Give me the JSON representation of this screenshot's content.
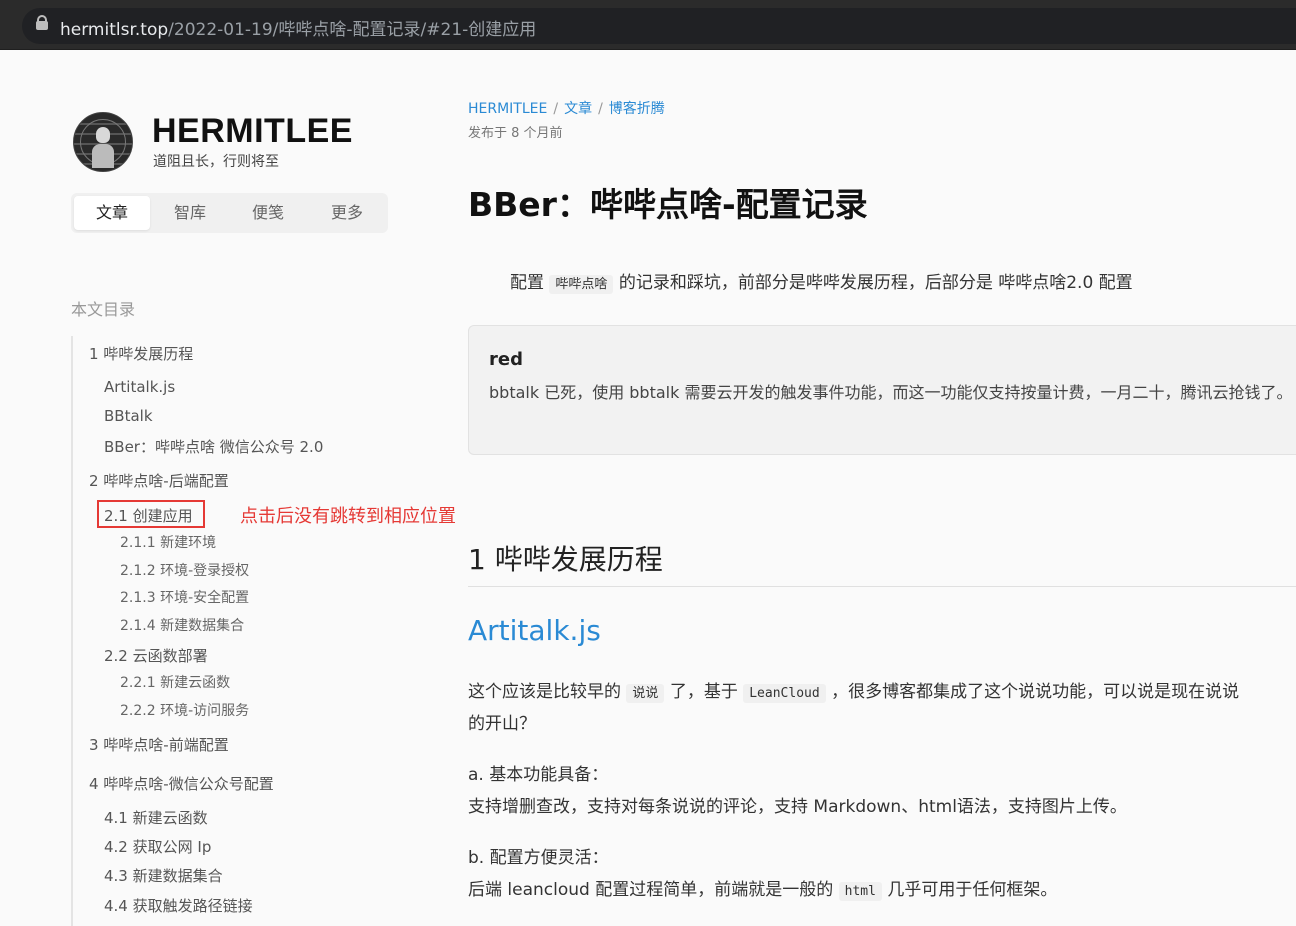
{
  "browser": {
    "url_host": "hermitlsr.top",
    "url_path": "/2022-01-19/哔哔点啥-配置记录/#21-创建应用"
  },
  "site": {
    "title": "HERMITLEE",
    "subtitle": "道阻且长，行则将至"
  },
  "nav": {
    "tabs": [
      {
        "label": "文章",
        "active": true
      },
      {
        "label": "智库",
        "active": false
      },
      {
        "label": "便笺",
        "active": false
      },
      {
        "label": "更多",
        "active": false
      }
    ]
  },
  "toc": {
    "title": "本文目录",
    "items": [
      {
        "label": "1 哔哔发展历程",
        "level": 1
      },
      {
        "label": "Artitalk.js",
        "level": 2
      },
      {
        "label": "BBtalk",
        "level": 2
      },
      {
        "label": "BBer：哔哔点啥 微信公众号 2.0",
        "level": 2
      },
      {
        "label": "2 哔哔点啥-后端配置",
        "level": 1
      },
      {
        "label": "2.1 创建应用",
        "level": 2,
        "highlighted": true
      },
      {
        "label": "2.1.1 新建环境",
        "level": 3
      },
      {
        "label": "2.1.2 环境-登录授权",
        "level": 3
      },
      {
        "label": "2.1.3 环境-安全配置",
        "level": 3
      },
      {
        "label": "2.1.4 新建数据集合",
        "level": 3
      },
      {
        "label": "2.2 云函数部署",
        "level": 2
      },
      {
        "label": "2.2.1 新建云函数",
        "level": 3
      },
      {
        "label": "2.2.2 环境-访问服务",
        "level": 3
      },
      {
        "label": "3 哔哔点啥-前端配置",
        "level": 1
      },
      {
        "label": "4 哔哔点啥-微信公众号配置",
        "level": 1
      },
      {
        "label": "4.1 新建云函数",
        "level": 2
      },
      {
        "label": "4.2 获取公网 Ip",
        "level": 2
      },
      {
        "label": "4.3 新建数据集合",
        "level": 2
      },
      {
        "label": "4.4 获取触发路径链接",
        "level": 2
      }
    ],
    "annotation": "点击后没有跳转到相应位置",
    "highlight_color": "#e53935"
  },
  "article": {
    "breadcrumb": [
      "HERMITLEE",
      "文章",
      "博客折腾"
    ],
    "published": "发布于 8 个月前",
    "title": "BBer：哔哔点啥-配置记录",
    "intro_pre": "配置",
    "intro_code": "哔哔点啥",
    "intro_post": "的记录和踩坑，前部分是哔哔发展历程，后部分是 哔哔点啥2.0 配置",
    "note_title": "red",
    "note_text": "bbtalk 已死，使用 bbtalk 需要云开发的触发事件功能，而这一功能仅支持按量计费，一月二十，腾讯云抢钱了。",
    "h2": "1 哔哔发展历程",
    "h3": "Artitalk.js",
    "p1_a": "这个应该是比较早的",
    "p1_code1": "说说",
    "p1_b": "了，基于",
    "p1_code2": "LeanCloud",
    "p1_c": "，很多博客都集成了这个说说功能，可以说是现在说说",
    "p1_line2": "的开山？",
    "p2_title": "a. 基本功能具备：",
    "p2_text": "支持增删查改，支持对每条说说的评论，支持 Markdown、html语法，支持图片上传。",
    "p3_title": "b. 配置方便灵活：",
    "p3_a": "后端 leancloud 配置过程简单，前端就是一般的",
    "p3_code": "html",
    "p3_b": "几乎可用于任何框架。"
  },
  "colors": {
    "link": "#2a8ad4",
    "annotation": "#e53935",
    "addressbar": "#2b2b2b"
  }
}
